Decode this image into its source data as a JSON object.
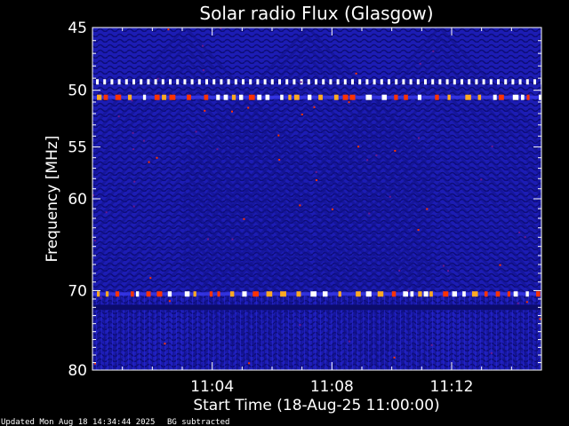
{
  "chart_data": {
    "type": "heatmap",
    "title": "Solar radio Flux (Glasgow)",
    "xlabel": "Start Time (18-Aug-25 11:00:00)",
    "ylabel": "Frequency [MHz]",
    "x_ticks": [
      "11:04",
      "11:08",
      "11:12"
    ],
    "x_tick_minutes": [
      4,
      8,
      12
    ],
    "xlim_minutes": [
      0,
      15
    ],
    "y_ticks": [
      45,
      50,
      55,
      60,
      70,
      80
    ],
    "ylim": [
      45,
      80
    ],
    "y_scale": "log",
    "grid": false,
    "colors": {
      "background": "#000000",
      "base": "#1c1cb4",
      "dark": "#0c0c6e",
      "bright": "#3a3aee",
      "hot": "#ff3300",
      "saturated": "#ffffff",
      "axis": "#ffffff"
    },
    "features": [
      {
        "type": "dotted_band",
        "frequency_mhz": 49.3
      },
      {
        "type": "bright_burst_band",
        "frequency_mhz": 50.6
      },
      {
        "type": "bright_burst_band",
        "frequency_mhz": 70.4
      },
      {
        "type": "dark_band",
        "frequency_mhz": 72.0
      }
    ]
  },
  "footer": {
    "updated": "Updated Mon Aug 18 14:34:44 2025",
    "note": "BG subtracted"
  }
}
